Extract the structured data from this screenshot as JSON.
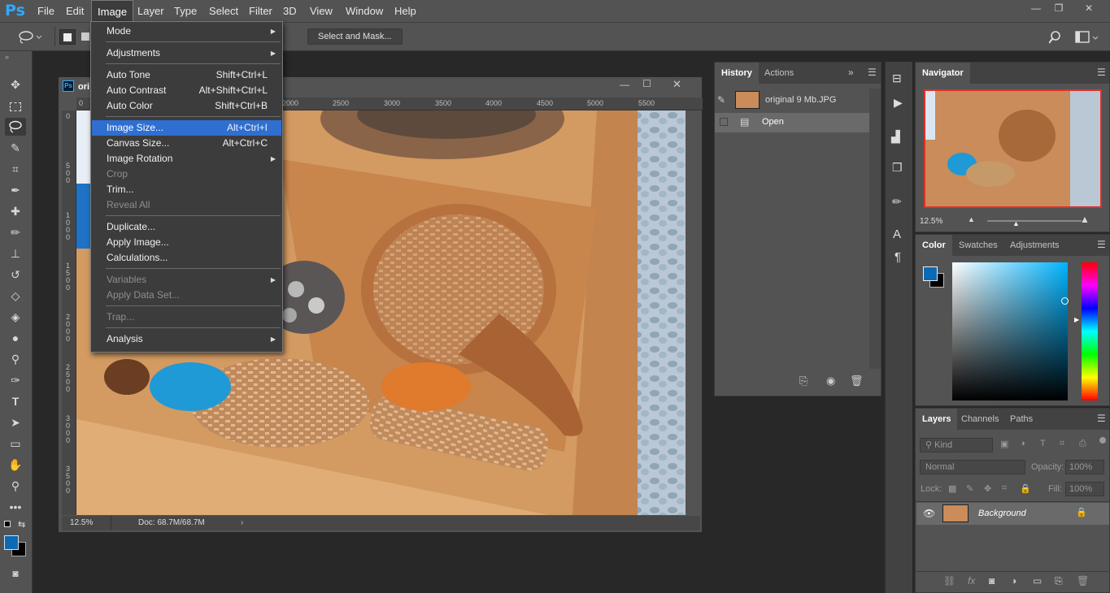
{
  "app": {
    "logo": "Ps"
  },
  "menubar": {
    "items": [
      "File",
      "Edit",
      "Image",
      "Layer",
      "Type",
      "Select",
      "Filter",
      "3D",
      "View",
      "Window",
      "Help"
    ],
    "active": "Image"
  },
  "window_controls": {
    "minimize": "—",
    "restore": "❐",
    "close": "✕"
  },
  "options_bar": {
    "select_and_mask": "Select and Mask...",
    "partial_label": "s"
  },
  "image_menu": [
    {
      "label": "Mode",
      "submenu": true
    },
    {
      "sep": true
    },
    {
      "label": "Adjustments",
      "submenu": true
    },
    {
      "sep": true
    },
    {
      "label": "Auto Tone",
      "shortcut": "Shift+Ctrl+L"
    },
    {
      "label": "Auto Contrast",
      "shortcut": "Alt+Shift+Ctrl+L"
    },
    {
      "label": "Auto Color",
      "shortcut": "Shift+Ctrl+B"
    },
    {
      "sep": true
    },
    {
      "label": "Image Size...",
      "shortcut": "Alt+Ctrl+I",
      "highlighted": true
    },
    {
      "label": "Canvas Size...",
      "shortcut": "Alt+Ctrl+C"
    },
    {
      "label": "Image Rotation",
      "submenu": true
    },
    {
      "label": "Crop",
      "disabled": true
    },
    {
      "label": "Trim..."
    },
    {
      "label": "Reveal All",
      "disabled": true
    },
    {
      "sep": true
    },
    {
      "label": "Duplicate..."
    },
    {
      "label": "Apply Image..."
    },
    {
      "label": "Calculations..."
    },
    {
      "sep": true
    },
    {
      "label": "Variables",
      "submenu": true,
      "disabled": true
    },
    {
      "label": "Apply Data Set...",
      "disabled": true
    },
    {
      "sep": true
    },
    {
      "label": "Trap...",
      "disabled": true
    },
    {
      "sep": true
    },
    {
      "label": "Analysis",
      "submenu": true
    }
  ],
  "document": {
    "title": "ori",
    "zoom": "12.5%",
    "doc_size": "Doc: 68.7M/68.7M",
    "ruler_top": [
      "0",
      "2000",
      "2500",
      "3000",
      "3500",
      "4000",
      "4500",
      "5000",
      "5500"
    ],
    "ruler_left": [
      "0",
      "5\n0\n0",
      "1\n0\n0\n0",
      "1\n5\n0\n0",
      "2\n0\n0\n0",
      "2\n5\n0\n0",
      "3\n0\n0\n0",
      "3\n5\n0\n0"
    ]
  },
  "history_panel": {
    "tabs": [
      "History",
      "Actions"
    ],
    "active_tab": "History",
    "snapshot": "original 9 Mb.JPG",
    "states": [
      "Open"
    ]
  },
  "navigator_panel": {
    "title": "Navigator",
    "zoom": "12.5%"
  },
  "color_panel": {
    "tabs": [
      "Color",
      "Swatches",
      "Adjustments"
    ],
    "active_tab": "Color",
    "foreground": "#0c6ab4",
    "background": "#000000"
  },
  "layers_panel": {
    "tabs": [
      "Layers",
      "Channels",
      "Paths"
    ],
    "active_tab": "Layers",
    "filter_kind": "Kind",
    "blend_mode": "Normal",
    "opacity_label": "Opacity:",
    "opacity_value": "100%",
    "lock_label": "Lock:",
    "fill_label": "Fill:",
    "fill_value": "100%",
    "layers": [
      {
        "name": "Background",
        "locked": true,
        "visible": true
      }
    ]
  },
  "icons": {
    "lasso": "lasso-icon",
    "search": "search-icon",
    "workspace": "workspace-icon"
  },
  "colors": {
    "accent": "#31a8ff",
    "menu_highlight": "#2e6fd1"
  }
}
